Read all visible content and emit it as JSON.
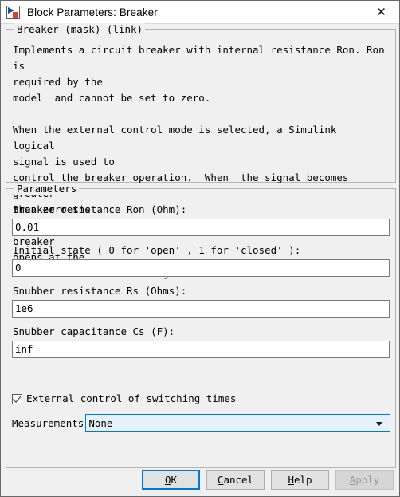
{
  "window": {
    "title": "Block Parameters: Breaker",
    "icon": "simulink-block-icon",
    "close_label": "✕"
  },
  "description_group": {
    "legend": "Breaker (mask) (link)",
    "text": "Implements a circuit breaker with internal resistance Ron. Ron is\nrequired by the\nmodel  and cannot be set to zero.\n\nWhen the external control mode is selected, a Simulink  logical\nsignal is used to\ncontrol the breaker operation.  When  the signal becomes greater\nthan zero the\nbreaker closes instantaneously.  When it becomes zero, the breaker\nopens at the\nnext current zero-crossing."
  },
  "parameters_group": {
    "legend": "Parameters",
    "fields": [
      {
        "label": "Breaker resistance Ron (Ohm):",
        "value": "0.01"
      },
      {
        "label": "Initial state ( 0 for 'open' , 1 for 'closed' ):",
        "value": "0"
      },
      {
        "label": "Snubber resistance Rs (Ohms):",
        "value": "1e6"
      },
      {
        "label": "Snubber capacitance Cs (F):",
        "value": "inf"
      }
    ],
    "checkbox": {
      "label": "External control of switching times",
      "checked": true
    },
    "combo": {
      "label": "Measurements",
      "value": "None",
      "arrow_icon": "chevron-down-icon"
    }
  },
  "buttons": {
    "ok": {
      "pre": "",
      "accel": "O",
      "post": "K",
      "default": true
    },
    "cancel": {
      "pre": "",
      "accel": "C",
      "post": "ancel",
      "default": false
    },
    "help": {
      "pre": "",
      "accel": "H",
      "post": "elp",
      "default": false
    },
    "apply": {
      "pre": "",
      "accel": "A",
      "post": "pply",
      "disabled": true
    }
  },
  "colors": {
    "dialog_bg": "#f0f0f0",
    "accent_blue": "#0078d7",
    "combo_bg": "#e5f1fb",
    "input_bg": "#ffffff",
    "disabled_text": "#9a9a9a"
  }
}
